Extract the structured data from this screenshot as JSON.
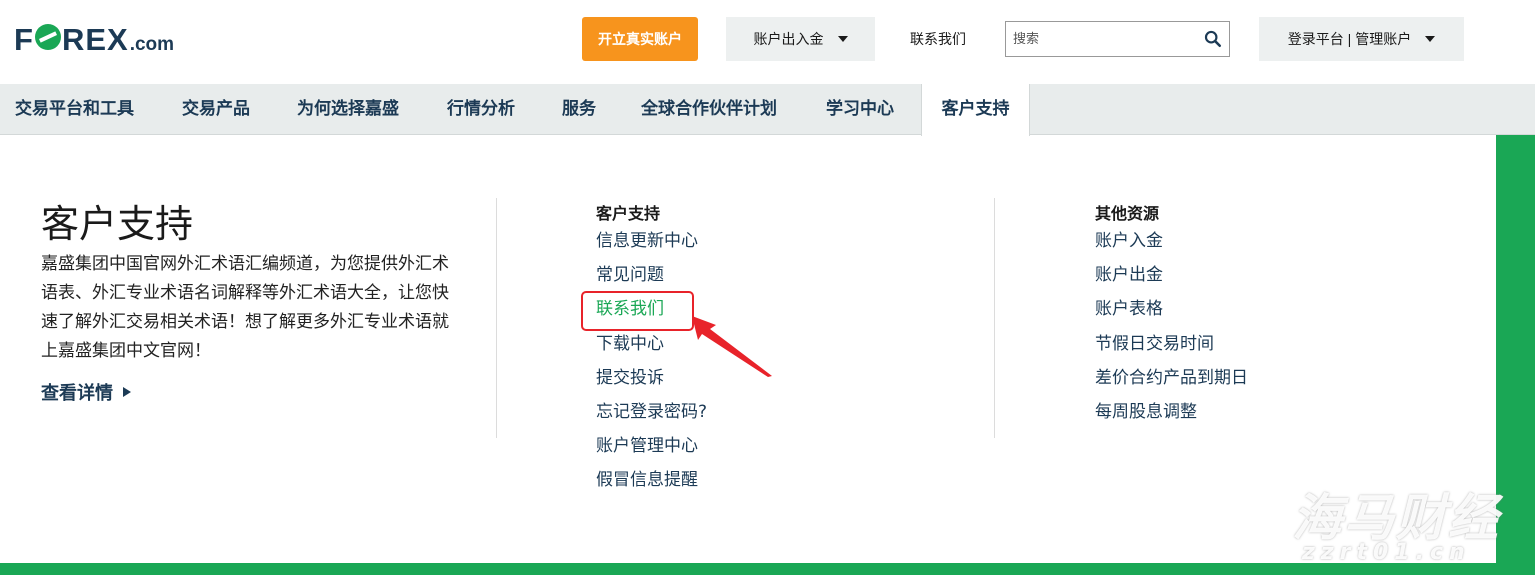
{
  "header": {
    "logo_main": "F",
    "logo_rest": "REX",
    "logo_suffix": ".com",
    "open_account_label": "开立真实账户",
    "funds_label": "账户出入金",
    "contact_label": "联系我们",
    "search_placeholder": "搜索",
    "login_label": "登录平台 | 管理账户"
  },
  "nav": {
    "items": [
      {
        "label": "交易平台和工具"
      },
      {
        "label": "交易产品"
      },
      {
        "label": "为何选择嘉盛"
      },
      {
        "label": "行情分析"
      },
      {
        "label": "服务"
      },
      {
        "label": "全球合作伙伴计划"
      },
      {
        "label": "学习中心"
      },
      {
        "label": "客户支持"
      }
    ],
    "active": "客户支持"
  },
  "panel": {
    "title": "客户支持",
    "description": "嘉盛集团中国官网外汇术语汇编频道，为您提供外汇术语表、外汇专业术语名词解释等外汇术语大全，让您快速了解外汇交易相关术语！想了解更多外汇专业术语就上嘉盛集团中文官网！",
    "more_label": "查看详情",
    "support_column": {
      "heading": "客户支持",
      "links": [
        "信息更新中心",
        "常见问题",
        "联系我们",
        "下载中心",
        "提交投诉",
        "忘记登录密码?",
        "账户管理中心",
        "假冒信息提醒"
      ]
    },
    "resources_column": {
      "heading": "其他资源",
      "links": [
        "账户入金",
        "账户出金",
        "账户表格",
        "节假日交易时间",
        "差价合约产品到期日",
        "每周股息调整"
      ]
    }
  },
  "watermark": {
    "brand": "海马财经",
    "domain": "zzrt01.cn"
  },
  "colors": {
    "brand_navy": "#1c3a55",
    "brand_green": "#1aa755",
    "cta_orange": "#f7941d",
    "annotation_red": "#e8232a"
  }
}
